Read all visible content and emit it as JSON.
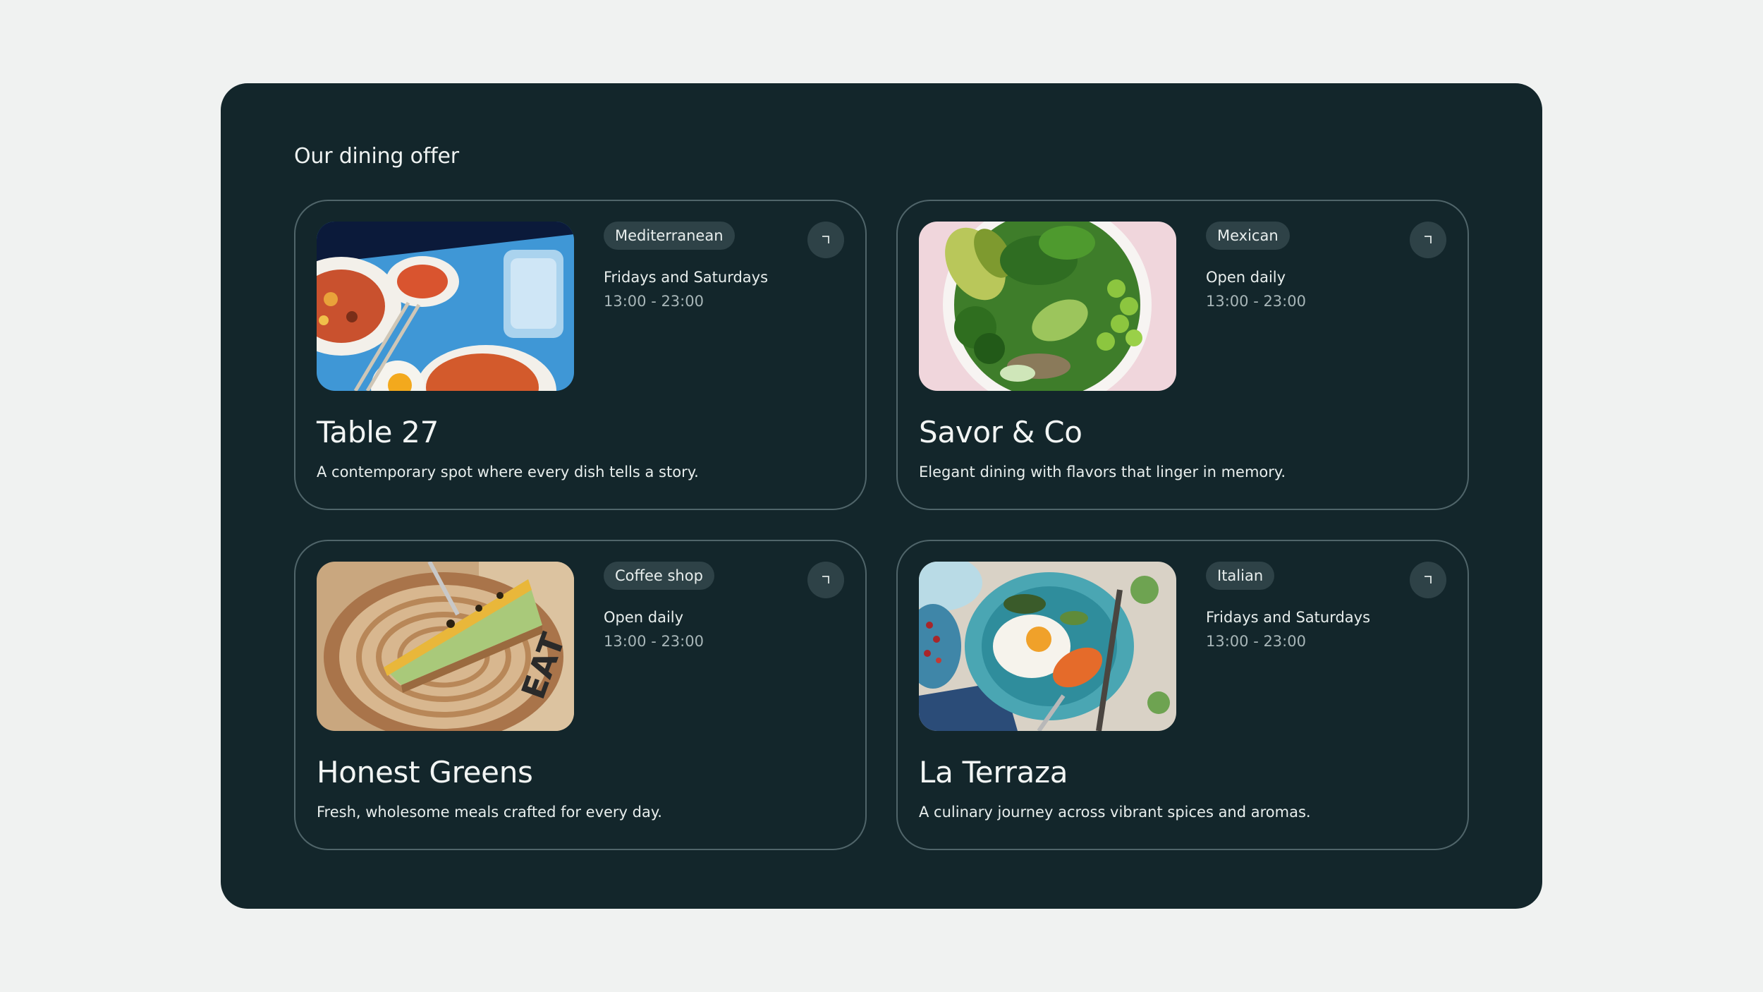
{
  "section": {
    "title": "Our dining offer"
  },
  "restaurants": [
    {
      "name": "Table 27",
      "tag": "Mediterranean",
      "schedule": "Fridays and Saturdays",
      "hours": "13:00 - 23:00",
      "description": "A contemporary spot where every dish tells a story.",
      "image_icon": "mediterranean-dishes-photo"
    },
    {
      "name": "Savor & Co",
      "tag": "Mexican",
      "schedule": "Open daily",
      "hours": "13:00 - 23:00",
      "description": "Elegant dining with flavors that linger in memory.",
      "image_icon": "green-salad-bowl-photo"
    },
    {
      "name": "Honest Greens",
      "tag": "Coffee shop",
      "schedule": "Open daily",
      "hours": "13:00 - 23:00",
      "description": "Fresh, wholesome meals crafted for every day.",
      "image_icon": "cheesecake-slice-photo"
    },
    {
      "name": "La Terraza",
      "tag": "Italian",
      "schedule": "Fridays and Saturdays",
      "hours": "13:00 - 23:00",
      "description": "A culinary journey across vibrant spices and aromas.",
      "image_icon": "egg-plate-photo"
    }
  ],
  "colors": {
    "page_bg": "#f0f2f1",
    "panel_bg": "#13262b",
    "card_border": "#50656a",
    "tag_bg": "#2e4247",
    "muted_text": "#a8b6b8"
  }
}
